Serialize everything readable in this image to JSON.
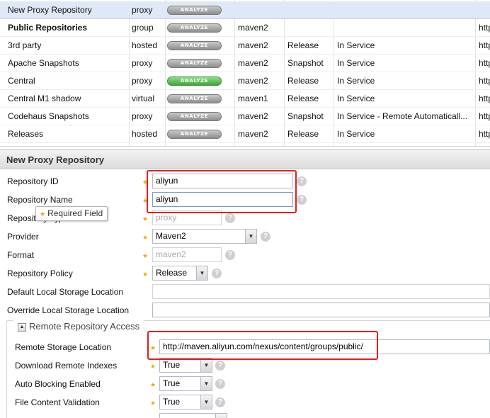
{
  "grid": {
    "rows": [
      {
        "name": "New Proxy Repository",
        "type": "proxy",
        "analyze": "ANALYZE",
        "analyze_green": false,
        "format": "",
        "policy": "",
        "status": "",
        "url": "",
        "selected": true,
        "bold": false
      },
      {
        "name": "Public Repositories",
        "type": "group",
        "analyze": "ANALYZE",
        "analyze_green": false,
        "format": "maven2",
        "policy": "",
        "status": "",
        "url": "http",
        "selected": false,
        "bold": true
      },
      {
        "name": "3rd party",
        "type": "hosted",
        "analyze": "ANALYZE",
        "analyze_green": false,
        "format": "maven2",
        "policy": "Release",
        "status": "In Service",
        "url": "http",
        "selected": false,
        "bold": false
      },
      {
        "name": "Apache Snapshots",
        "type": "proxy",
        "analyze": "ANALYZE",
        "analyze_green": false,
        "format": "maven2",
        "policy": "Snapshot",
        "status": "In Service",
        "url": "http",
        "selected": false,
        "bold": false
      },
      {
        "name": "Central",
        "type": "proxy",
        "analyze": "ANALYZE",
        "analyze_green": true,
        "format": "maven2",
        "policy": "Release",
        "status": "In Service",
        "url": "http",
        "selected": false,
        "bold": false
      },
      {
        "name": "Central M1 shadow",
        "type": "virtual",
        "analyze": "ANALYZE",
        "analyze_green": false,
        "format": "maven1",
        "policy": "Release",
        "status": "In Service",
        "url": "http",
        "selected": false,
        "bold": false
      },
      {
        "name": "Codehaus Snapshots",
        "type": "proxy",
        "analyze": "ANALYZE",
        "analyze_green": false,
        "format": "maven2",
        "policy": "Snapshot",
        "status": "In Service - Remote Automaticall...",
        "url": "http",
        "selected": false,
        "bold": false
      },
      {
        "name": "Releases",
        "type": "hosted",
        "analyze": "ANALYZE",
        "analyze_green": false,
        "format": "maven2",
        "policy": "Release",
        "status": "In Service",
        "url": "http",
        "selected": false,
        "bold": false
      }
    ]
  },
  "panel": {
    "title": "New Proxy Repository"
  },
  "form": {
    "repository_id": {
      "label": "Repository ID",
      "value": "aliyun"
    },
    "repository_name": {
      "label": "Repository Name",
      "value": "aliyun"
    },
    "repository_type": {
      "label": "Repository Type",
      "value": "proxy"
    },
    "provider": {
      "label": "Provider",
      "value": "Maven2"
    },
    "format": {
      "label": "Format",
      "value": "maven2"
    },
    "repository_policy": {
      "label": "Repository Policy",
      "value": "Release"
    },
    "default_storage": {
      "label": "Default Local Storage Location",
      "value": ""
    },
    "override_storage": {
      "label": "Override Local Storage Location",
      "value": ""
    },
    "tooltip": "Required Field",
    "remote_section": {
      "title": "Remote Repository Access",
      "remote_storage": {
        "label": "Remote Storage Location",
        "value": "http://maven.aliyun.com/nexus/content/groups/public/"
      },
      "download_indexes": {
        "label": "Download Remote Indexes",
        "value": "True"
      },
      "auto_blocking": {
        "label": "Auto Blocking Enabled",
        "value": "True"
      },
      "file_validation": {
        "label": "File Content Validation",
        "value": "True"
      }
    }
  },
  "icons": {
    "help": "help-icon",
    "required": "required-star-icon",
    "dropdown": "dropdown-arrow-icon",
    "collapse": "collapse-icon"
  },
  "colors": {
    "highlight": "#e81c1c",
    "selected_row": "#dfe8f6",
    "analyze_green": "#3fa63a"
  }
}
